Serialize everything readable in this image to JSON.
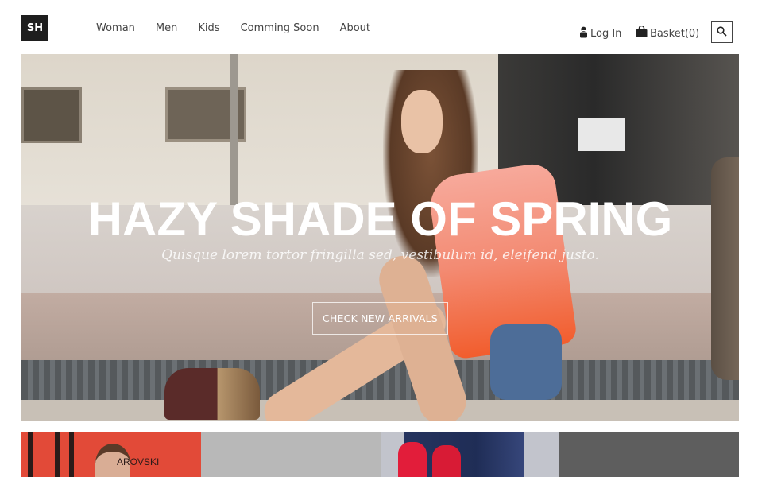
{
  "header": {
    "logo": "SH",
    "nav": [
      "Woman",
      "Men",
      "Kids",
      "Comming Soon",
      "About"
    ],
    "login_label": "Log In",
    "basket_label": "Basket(0)",
    "icons": {
      "login": "user-icon",
      "basket": "shopping-bag-icon",
      "search": "search-icon"
    }
  },
  "hero": {
    "title": "HAZY SHADE OF SPRING",
    "subtitle": "Quisque lorem tortor fringilla sed, vestibulum id, eleifend justo.",
    "cta_label": "CHECK NEW ARRIVALS"
  },
  "tiles": [
    {
      "name": "tile-red-carpet",
      "text": "AROVSKI",
      "color": "#e24a38"
    },
    {
      "name": "tile-gray",
      "color": "#b8b8b8"
    },
    {
      "name": "tile-red-shoes",
      "color": "#c2c4cc"
    },
    {
      "name": "tile-dark-gray",
      "color": "#5e5e5e"
    }
  ]
}
